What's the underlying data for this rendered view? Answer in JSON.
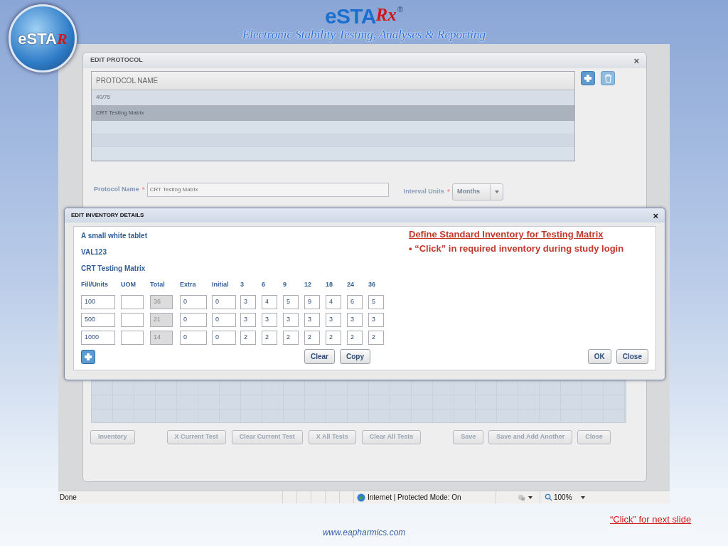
{
  "slide": {
    "logo": {
      "text": "eSTA",
      "mark": "R"
    },
    "title": {
      "text": "eSTA",
      "mark": "Rx",
      "symbol": "®"
    },
    "subtitle": "Electronic Stability Testing, Analyses & Reporting",
    "next_link": "“Click” for next slide",
    "website": "www.eapharmics.com"
  },
  "edit_protocol": {
    "title": "EDIT PROTOCOL",
    "close": "×",
    "list_header": "PROTOCOL NAME",
    "rows": [
      {
        "name": "40/75",
        "selected": false
      },
      {
        "name": "CRT Testing Matrix",
        "selected": true
      }
    ],
    "protocol_name_label": "Protocol Name",
    "protocol_name_value": "CRT Testing Matrix",
    "interval_units_label": "Interval Units",
    "interval_units_value": "Months",
    "required_mark": "*",
    "buttons": [
      {
        "label": "Inventory",
        "disabled": true
      },
      {
        "label": "X Current Test",
        "disabled": true
      },
      {
        "label": "Clear Current Test",
        "disabled": true
      },
      {
        "label": "X All Tests",
        "disabled": true
      },
      {
        "label": "Clear All Tests",
        "disabled": true
      },
      {
        "label": "Save",
        "disabled": true
      },
      {
        "label": "Save and Add Another",
        "disabled": true
      },
      {
        "label": "Close",
        "disabled": true
      }
    ]
  },
  "edit_inventory": {
    "title": "EDIT INVENTORY DETAILS",
    "close": "×",
    "product": "A small white tablet",
    "code": "VAL123",
    "protocol": "CRT Testing Matrix",
    "note_heading": "Define Standard Inventory for Testing Matrix",
    "note_bullet": "• “Click” in required inventory during study login",
    "columns": [
      "Fill/Units",
      "UOM",
      "Total",
      "Extra",
      "Initial",
      "3",
      "6",
      "9",
      "12",
      "18",
      "24",
      "36"
    ],
    "rows": [
      {
        "cells": [
          {
            "value": "100",
            "disabled": false
          },
          {
            "disabled": false
          },
          {
            "value": "36",
            "disabled": true
          },
          {
            "value": "0",
            "disabled": false
          },
          {
            "value": "0",
            "disabled": false
          },
          {
            "value": "3",
            "disabled": false
          },
          {
            "value": "4",
            "disabled": false
          },
          {
            "value": "5",
            "disabled": false
          },
          {
            "value": "9",
            "disabled": false
          },
          {
            "value": "4",
            "disabled": false
          },
          {
            "value": "6",
            "disabled": false
          },
          {
            "value": "5",
            "disabled": false
          }
        ]
      },
      {
        "cells": [
          {
            "value": "500",
            "disabled": false
          },
          {
            "disabled": false
          },
          {
            "value": "21",
            "disabled": true
          },
          {
            "value": "0",
            "disabled": false
          },
          {
            "value": "0",
            "disabled": false
          },
          {
            "value": "3",
            "disabled": false
          },
          {
            "value": "3",
            "disabled": false
          },
          {
            "value": "3",
            "disabled": false
          },
          {
            "value": "3",
            "disabled": false
          },
          {
            "value": "3",
            "disabled": false
          },
          {
            "value": "3",
            "disabled": false
          },
          {
            "value": "3",
            "disabled": false
          }
        ]
      },
      {
        "cells": [
          {
            "value": "1000",
            "disabled": false
          },
          {
            "disabled": false
          },
          {
            "value": "14",
            "disabled": true
          },
          {
            "value": "0",
            "disabled": false
          },
          {
            "value": "0",
            "disabled": false
          },
          {
            "value": "2",
            "disabled": false
          },
          {
            "value": "2",
            "disabled": false
          },
          {
            "value": "2",
            "disabled": false
          },
          {
            "value": "2",
            "disabled": false
          },
          {
            "value": "2",
            "disabled": false
          },
          {
            "value": "2",
            "disabled": false
          },
          {
            "value": "2",
            "disabled": false
          }
        ]
      }
    ],
    "buttons": [
      "Clear",
      "Copy"
    ],
    "dialog_buttons": [
      "OK",
      "Close"
    ]
  },
  "status_bar": {
    "status": "Done",
    "zone": "Internet | Protected Mode: On",
    "zoom": "100%"
  }
}
